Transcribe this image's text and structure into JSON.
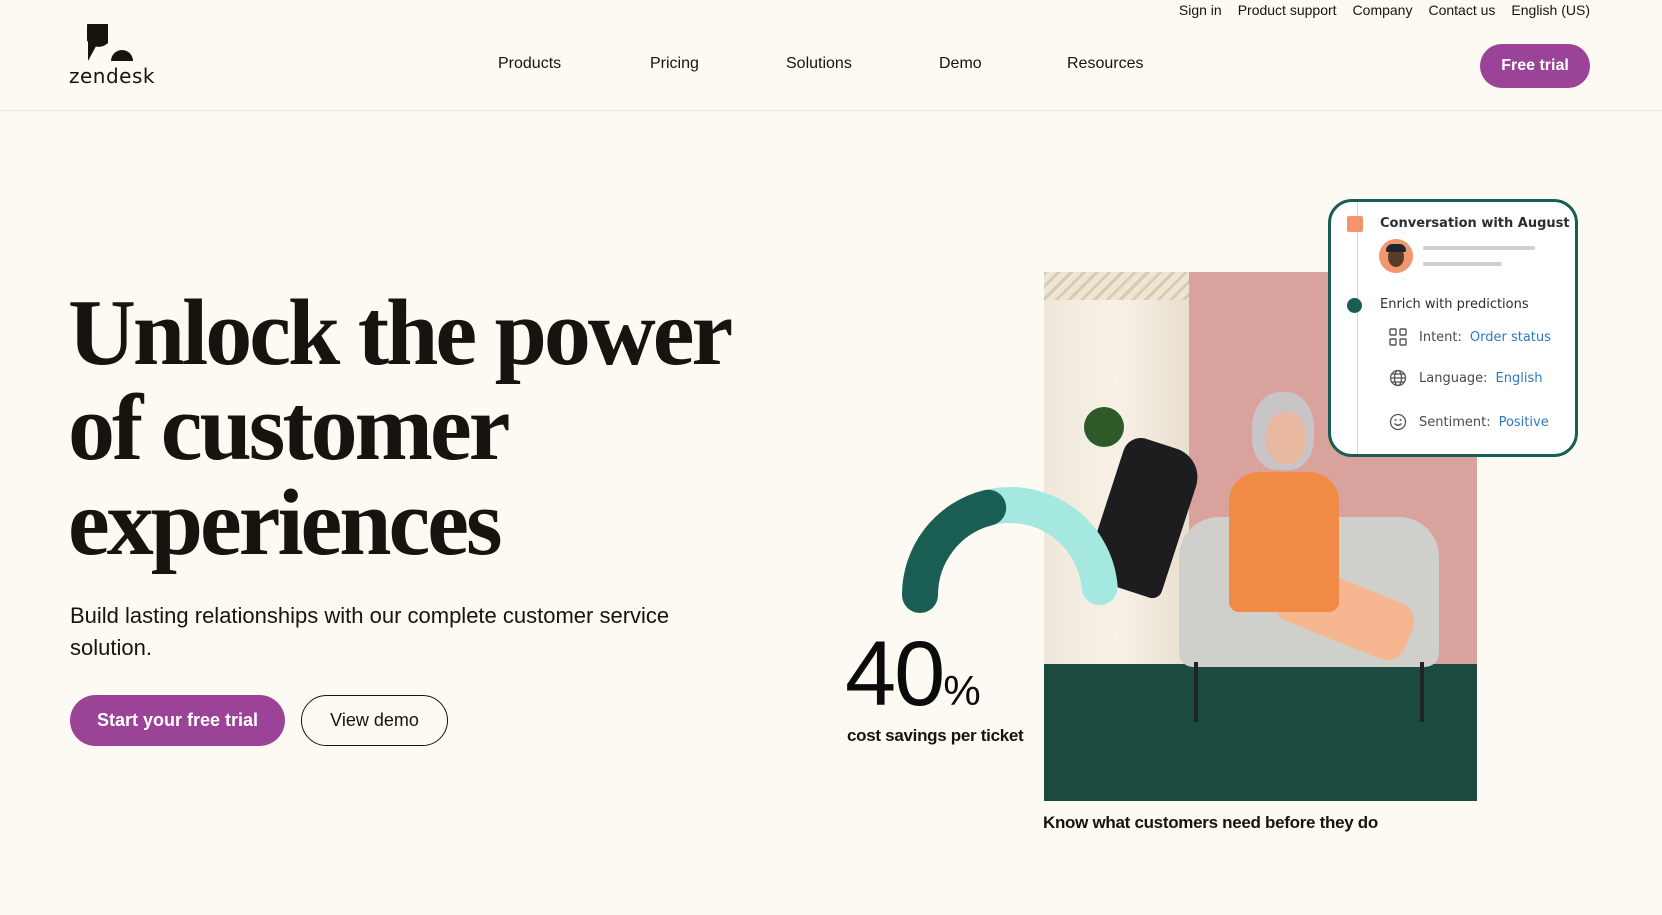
{
  "header": {
    "brand": "zendesk",
    "utility_links": [
      "Sign in",
      "Product support",
      "Company",
      "Contact us",
      "English (US)"
    ],
    "nav": [
      "Products",
      "Pricing",
      "Solutions",
      "Demo",
      "Resources"
    ],
    "cta": "Free trial"
  },
  "hero": {
    "headline_lines": [
      "Unlock the power",
      "of customer",
      "experiences"
    ],
    "subheadline": "Build lasting relationships with our complete customer service solution.",
    "primary_cta": "Start your free trial",
    "secondary_cta": "View demo"
  },
  "visual": {
    "stat": {
      "value": "40",
      "unit": "%",
      "label": "cost savings per ticket",
      "gauge_fraction": 0.4
    },
    "caption": "Know what customers need before they do",
    "card": {
      "title": "Conversation with August",
      "step": "Enrich with predictions",
      "rows": [
        {
          "icon": "grid-icon",
          "label": "Intent:",
          "value": "Order status"
        },
        {
          "icon": "globe-icon",
          "label": "Language:",
          "value": "English"
        },
        {
          "icon": "smiley-icon",
          "label": "Sentiment:",
          "value": "Positive"
        }
      ]
    }
  },
  "colors": {
    "brand_purple": "#9b4497",
    "accent_green": "#1a5e53",
    "accent_mint": "#a5e8df",
    "link_blue": "#2e78c2",
    "background": "#fdf9f3"
  }
}
